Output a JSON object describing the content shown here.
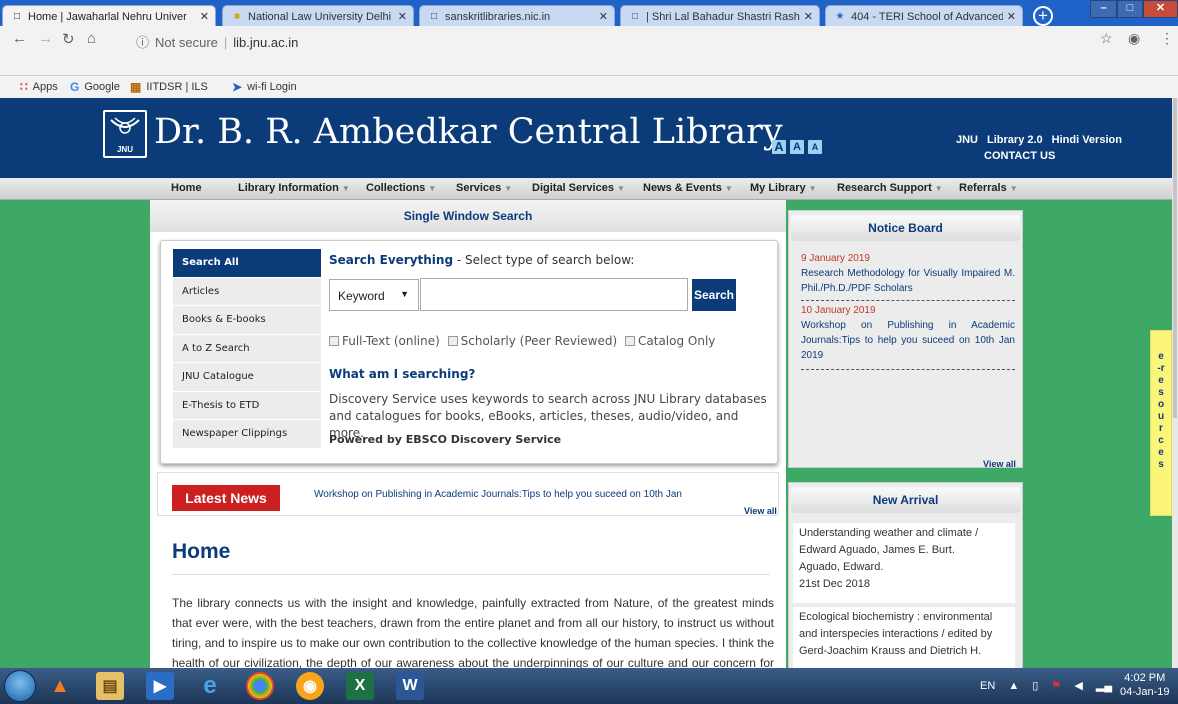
{
  "tabs": [
    {
      "title": "Home | Jawaharlal Nehru Univer",
      "active": true
    },
    {
      "title": "National Law University Delhi",
      "active": false
    },
    {
      "title": "sanskritlibraries.nic.in",
      "active": false
    },
    {
      "title": "| Shri Lal Bahadur Shastri Rashtr",
      "active": false
    },
    {
      "title": "404 - TERI School of Advanced",
      "active": false
    }
  ],
  "address": {
    "security": "Not secure",
    "url": "lib.jnu.ac.in"
  },
  "bookmarks": [
    {
      "label": "Apps",
      "icon": "apps-grid-icon"
    },
    {
      "label": "Google",
      "icon": "google-g-icon"
    },
    {
      "label": "IITDSR | ILS",
      "icon": "site-icon"
    },
    {
      "label": "wi-fi Login",
      "icon": "wifi-icon"
    }
  ],
  "header": {
    "title": "Dr. B. R. Ambedkar Central Library",
    "logo_text": "JNU",
    "font_sizes": [
      "A",
      "A",
      "A"
    ],
    "links": [
      "JNU",
      "Library 2.0",
      "Hindi Version"
    ],
    "contact": "CONTACT US"
  },
  "menu": [
    {
      "label": "Home",
      "dropdown": false
    },
    {
      "label": "Library Information",
      "dropdown": true
    },
    {
      "label": "Collections",
      "dropdown": true
    },
    {
      "label": "Services",
      "dropdown": true
    },
    {
      "label": "Digital Services",
      "dropdown": true
    },
    {
      "label": "News & Events",
      "dropdown": true
    },
    {
      "label": "My Library",
      "dropdown": true
    },
    {
      "label": "Research Support",
      "dropdown": true
    },
    {
      "label": "Referrals",
      "dropdown": true
    }
  ],
  "search": {
    "heading": "Single Window Search",
    "tabs": [
      "Search All",
      "Articles",
      "Books & E-books",
      "A to Z Search",
      "JNU Catalogue",
      "E-Thesis to ETD",
      "Newspaper Clippings"
    ],
    "title_bold": "Search Everything",
    "title_rest": " - Select type of search below:",
    "select_value": "Keyword",
    "input_value": "",
    "button": "Search",
    "options": [
      "Full-Text (online)",
      "Scholarly (Peer Reviewed)",
      "Catalog Only"
    ],
    "what_heading": "What am I searching?",
    "description": "Discovery Service uses keywords to search across JNU Library databases and catalogues for books, eBooks, articles, theses, audio/video, and more.",
    "powered": "Powered by EBSCO Discovery Service"
  },
  "latest_news": {
    "label": "Latest News",
    "text": "Workshop on Publishing in Academic Journals:Tips to help you suceed on 10th Jan",
    "view_all": "View all"
  },
  "home": {
    "heading": "Home",
    "paragraph": "The library connects us with the insight and knowledge, painfully extracted from Nature, of the greatest minds that ever were, with the best teachers, drawn from the entire planet and from all our history, to instruct us without tiring, and to inspire us to make our own contribution to the collective knowledge of the human species. I think the health of our civilization, the depth of our awareness about the underpinnings of our culture and our concern for the future can"
  },
  "notice_board": {
    "heading": "Notice Board",
    "items": [
      {
        "date": "9 January 2019",
        "text": "Research Methodology for Visually Impaired M. Phil./Ph.D./PDF Scholars"
      },
      {
        "date": "10 January 2019",
        "text": "Workshop on Publishing in Academic Journals:Tips to help you suceed on 10th Jan 2019"
      }
    ],
    "view_all": "View all"
  },
  "new_arrival": {
    "heading": "New Arrival",
    "items": [
      {
        "lines": [
          "Understanding weather and climate /",
          "Edward Aguado, James E. Burt.",
          "Aguado, Edward.",
          "21st Dec 2018"
        ]
      },
      {
        "lines": [
          "Ecological biochemistry : environmental",
          "and interspecies interactions / edited by",
          "Gerd-Joachim Krauss and Dietrich H."
        ]
      }
    ]
  },
  "eresources": "e-resources",
  "taskbar": {
    "lang": "EN",
    "time": "4:02 PM",
    "date": "04-Jan-19"
  },
  "colors": {
    "brand": "#0b3c79",
    "page_bg": "#3ea866",
    "latest_news": "#cc1f1f",
    "notice_date": "#c0392b"
  }
}
